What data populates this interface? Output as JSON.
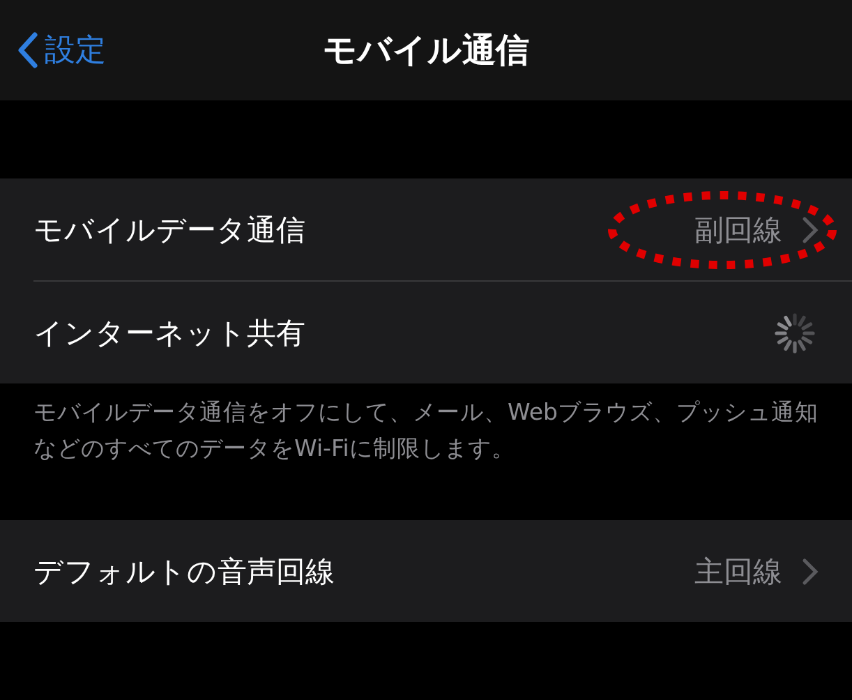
{
  "nav": {
    "back": "設定",
    "title": "モバイル通信"
  },
  "groups": [
    {
      "rows": [
        {
          "kind": "link",
          "label": "モバイルデータ通信",
          "value": "副回線",
          "circled": true
        },
        {
          "kind": "loading",
          "label": "インターネット共有",
          "circled": false
        }
      ],
      "footer": "モバイルデータ通信をオフにして、メール、Webブラウズ、プッシュ通知などのすべてのデータをWi-Fiに制限します。"
    },
    {
      "rows": [
        {
          "kind": "link",
          "label": "デフォルトの音声回線",
          "value": "主回線",
          "circled": false
        }
      ]
    }
  ]
}
